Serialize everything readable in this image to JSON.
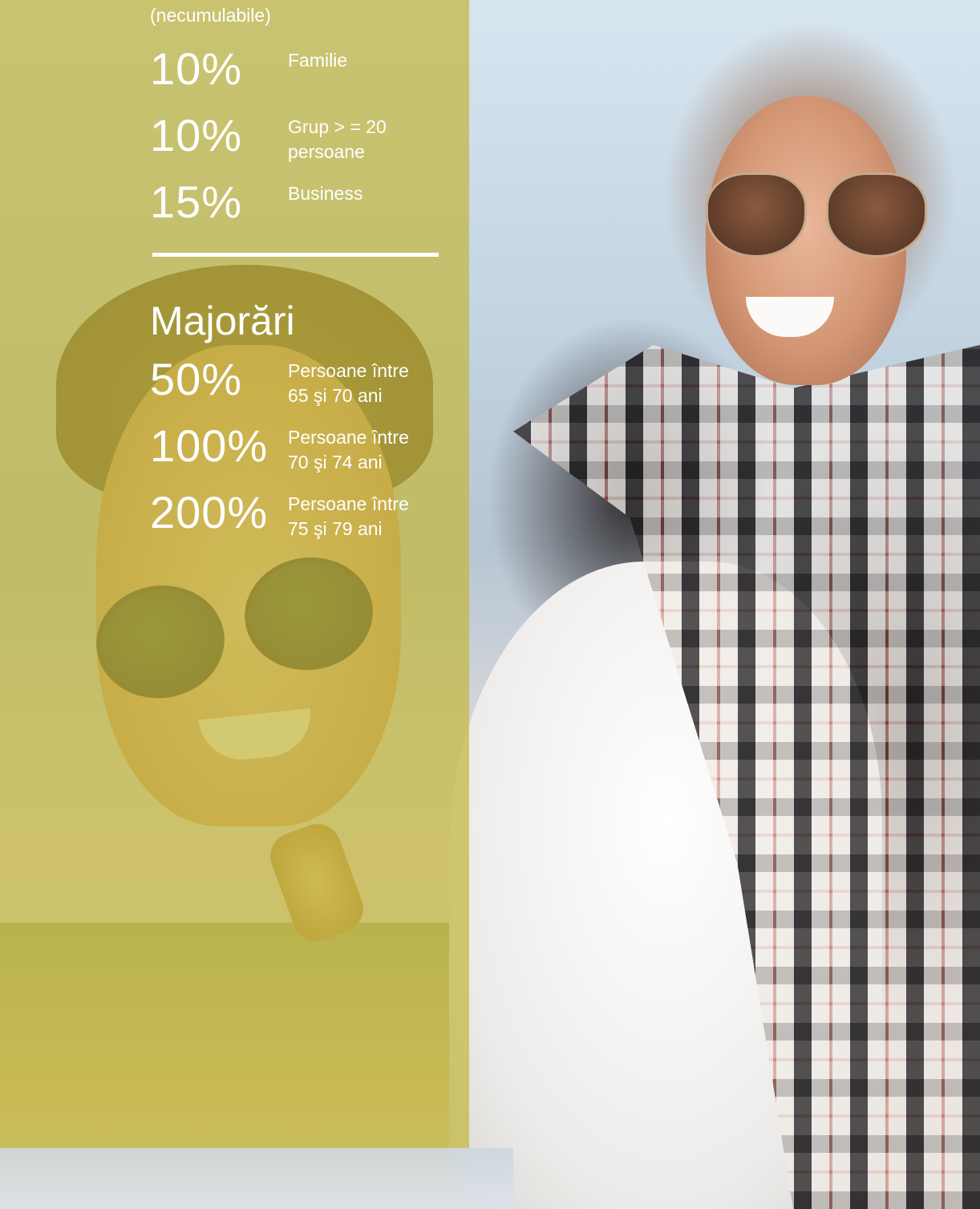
{
  "discounts": {
    "subtitle": "(necumulabile)",
    "items": [
      {
        "percent": "10%",
        "label": "Familie"
      },
      {
        "percent": "10%",
        "label": "Grup > = 20 persoane"
      },
      {
        "percent": "15%",
        "label": "Business"
      }
    ]
  },
  "surcharges": {
    "title": "Majorări",
    "items": [
      {
        "percent": "50%",
        "label": "Persoane între 65 şi 70 ani"
      },
      {
        "percent": "100%",
        "label": "Persoane între 70 şi 74 ani"
      },
      {
        "percent": "200%",
        "label": "Persoane între 75 şi 79 ani"
      }
    ]
  },
  "colors": {
    "panel_overlay": "#c4b844",
    "text": "#ffffff"
  },
  "image": {
    "icon": "photo-couple-piggyback"
  }
}
